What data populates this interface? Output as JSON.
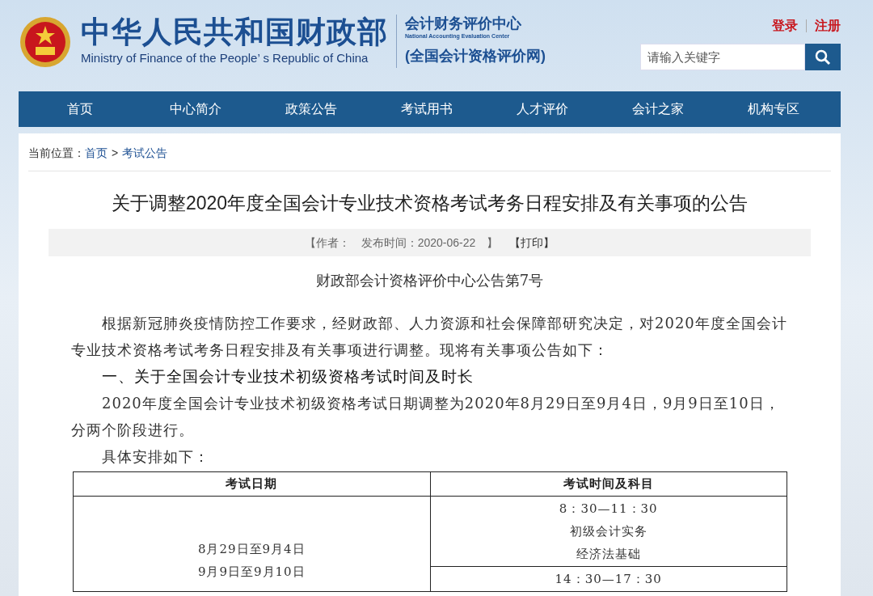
{
  "header": {
    "ministry_name": "中华人民共和国财政部",
    "ministry_name_en": "Ministry of Finance of the People’ s Republic of China",
    "center_name": "会计财务评价中心",
    "center_name_en": "National Accounting Evaluation Center",
    "site_name": "(全国会计资格评价网)",
    "links": [
      "登录",
      "注册"
    ],
    "search": {
      "placeholder": "请输入关键字"
    }
  },
  "nav": [
    {
      "label": "首页"
    },
    {
      "label": "中心简介"
    },
    {
      "label": "政策公告"
    },
    {
      "label": "考试用书"
    },
    {
      "label": "人才评价"
    },
    {
      "label": "会计之家"
    },
    {
      "label": "机构专区"
    }
  ],
  "breadcrumb": {
    "label": "当前位置：",
    "items": [
      "首页",
      "考试公告"
    ],
    "separator": ">"
  },
  "article": {
    "title": "关于调整2020年度全国会计专业技术资格考试考务日程安排及有关事项的公告",
    "meta": [
      "【作者：",
      "发布时间：2020-06-22",
      "】",
      "【打印】"
    ],
    "doc_number": "财政部会计资格评价中心公告第7号",
    "blocks": [
      {
        "kind": "paragraph",
        "text": "根据新冠肺炎疫情防控工作要求，经财政部、人力资源和社会保障部研究决定，对2020年度全国会计专业技术资格考试考务日程安排及有关事项进行调整。现将有关事项公告如下："
      },
      {
        "kind": "heading",
        "text": "一、关于全国会计专业技术初级资格考试时间及时长"
      },
      {
        "kind": "paragraph",
        "text": "2020年度全国会计专业技术初级资格考试日期调整为2020年8月29日至9月4日，9月9日至10日，分两个阶段进行。"
      },
      {
        "kind": "paragraph",
        "text": "具体安排如下："
      }
    ],
    "table": {
      "columns": [
        "考试日期",
        "考试时间及科目"
      ],
      "dates": [
        "8月29日至9月4日",
        "9月9日至9月10日"
      ],
      "sessions": [
        {
          "lines": [
            "8：30—11：30",
            "初级会计实务",
            "经济法基础"
          ]
        },
        {
          "lines": [
            "14：30—17：30"
          ]
        }
      ]
    }
  }
}
